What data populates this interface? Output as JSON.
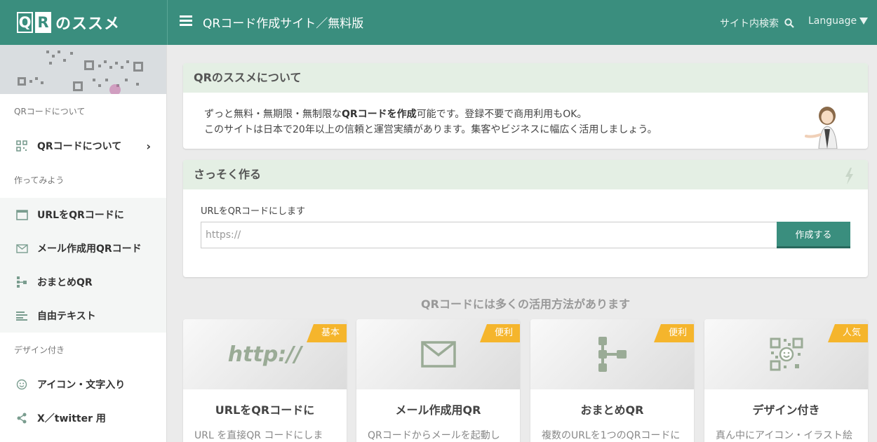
{
  "header": {
    "logo_q": "Q",
    "logo_r": "R",
    "logo_text": "のススメ",
    "title": "QRコード作成サイト／無料版",
    "search_label": "サイト内検索",
    "language_label": "Language"
  },
  "sidebar": {
    "sections": [
      {
        "label": "QRコードについて"
      },
      {
        "label": "作ってみよう"
      },
      {
        "label": "デザイン付き"
      }
    ],
    "items": [
      {
        "label": "QRコードについて",
        "icon": "qr-icon"
      },
      {
        "label": "URLをQRコードに",
        "icon": "browser-window-icon"
      },
      {
        "label": "メール作成用QRコード",
        "icon": "envelope-icon"
      },
      {
        "label": "おまとめQR",
        "icon": "tree-icon"
      },
      {
        "label": "自由テキスト",
        "icon": "text-lines-icon"
      },
      {
        "label": "アイコン・文字入り",
        "icon": "smiley-icon"
      },
      {
        "label": "X／twitter 用",
        "icon": "share-icon"
      }
    ],
    "arrow": "›"
  },
  "about": {
    "heading": "QRのススメについて",
    "line1_pre": "ずっと無料・無期限・無制限な",
    "line1_bold": "QRコードを作成",
    "line1_post": "可能です。登録不要で商用利用もOK。",
    "line2": "このサイトは日本で20年以上の信頼と運営実績があります。集客やビジネスに幅広く活用しましょう。"
  },
  "quick": {
    "heading": "さっそく作る",
    "form_label": "URLをQRコードにします",
    "input_placeholder": "https://",
    "input_value": "",
    "button_label": "作成する"
  },
  "uses": {
    "heading": "QRコードには多くの活用方法があります",
    "cards": [
      {
        "badge": "基本",
        "title": "URLをQRコードに",
        "desc": "URL を直接QR コードにしま",
        "image_text": "http://",
        "icon": "http-icon"
      },
      {
        "badge": "便利",
        "title": "メール作成用QR",
        "desc": "QRコードからメールを起動し",
        "icon": "envelope-icon"
      },
      {
        "badge": "便利",
        "title": "おまとめQR",
        "desc": "複数のURLを1つのQRコードに",
        "icon": "tree-icon"
      },
      {
        "badge": "人気",
        "title": "デザイン付き",
        "desc": "真ん中にアイコン・イラスト絵",
        "icon": "qr-smiley-icon"
      }
    ]
  },
  "colors": {
    "brand": "#3a8e7e",
    "badge": "#f5b52c",
    "panel_header": "#e4efe4",
    "icon_green": "#7a9d8f"
  }
}
